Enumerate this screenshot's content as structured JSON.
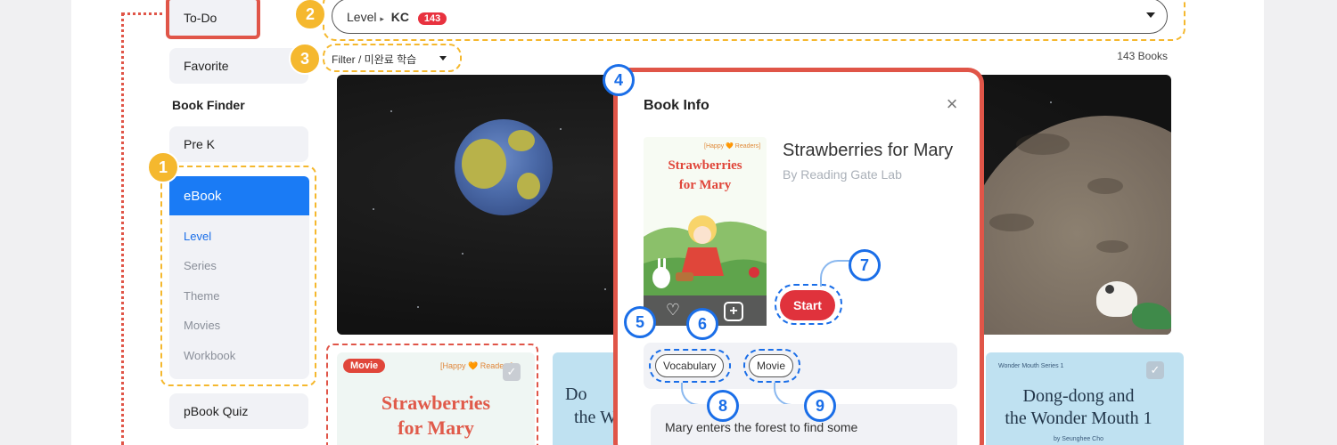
{
  "sidebar": {
    "todo": "To-Do",
    "favorite": "Favorite",
    "book_finder": "Book Finder",
    "prek": "Pre K",
    "ebook": "eBook",
    "items": [
      "Level",
      "Series",
      "Theme",
      "Movies",
      "Workbook"
    ],
    "pbook_quiz": "pBook Quiz"
  },
  "header": {
    "level_label": "Level",
    "level_sep": "▸",
    "level_value": "KC",
    "level_count": "143",
    "filter_label": "Filter / 미완료 학습",
    "books_count": "143 Books"
  },
  "callouts": [
    "1",
    "2",
    "3",
    "4",
    "5",
    "6",
    "7",
    "8",
    "9"
  ],
  "cards": {
    "movie_tag": "Movie",
    "series_label": "[Happy 🧡 Readers]",
    "card1_title_line1": "Strawberries",
    "card1_title_line2": "for Mary",
    "card2_title_line1": "Do",
    "card2_title_line2": "the W",
    "card3_series": "Wonder Mouth Series 1",
    "card3_title_line1": "Dong-dong and",
    "card3_title_line2": "the Wonder Mouth 1",
    "card3_author": "by Seunghee Cho",
    "check": "✓"
  },
  "modal": {
    "title": "Book Info",
    "close": "×",
    "cover_series": "[Happy 🧡 Readers]",
    "cover_title_line1": "Strawberries",
    "cover_title_line2": "for Mary",
    "book_title": "Strawberries for Mary",
    "author": "By Reading Gate Lab",
    "start": "Start",
    "tag_vocabulary": "Vocabulary",
    "tag_movie": "Movie",
    "summary": "Mary enters the forest to find some"
  },
  "colors": {
    "accent_red": "#e05548",
    "accent_blue": "#1a7bf5",
    "callout_yellow": "#f5b82e",
    "start_red": "#e0323c"
  }
}
